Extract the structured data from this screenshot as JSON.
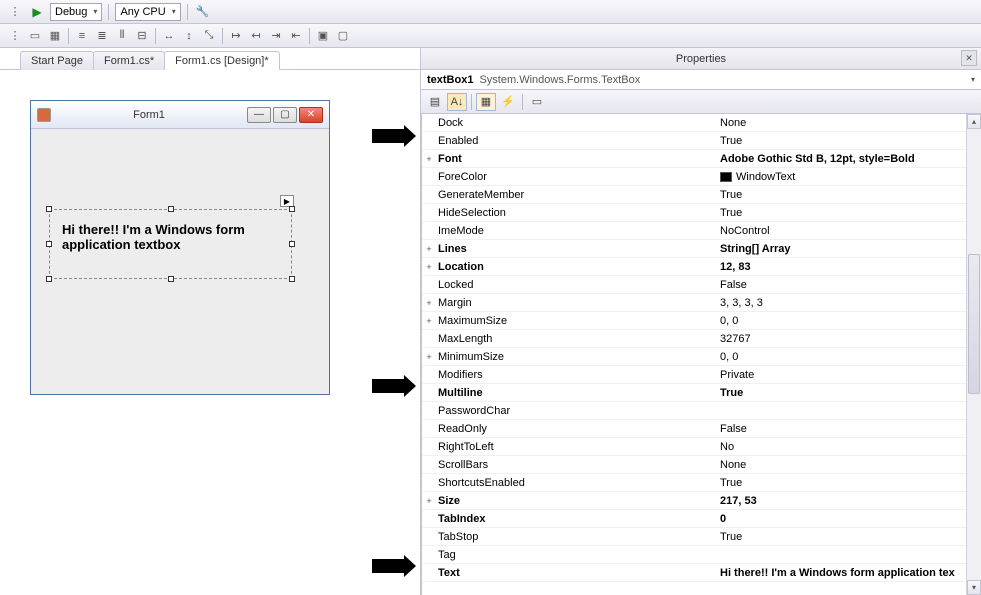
{
  "toolbar": {
    "config": "Debug",
    "platform": "Any CPU"
  },
  "tabs": {
    "start": "Start Page",
    "code": "Form1.cs*",
    "design": "Form1.cs [Design]*"
  },
  "form": {
    "title": "Form1",
    "textbox_text": "Hi there!! I'm a Windows form application textbox"
  },
  "properties": {
    "panel_title": "Properties",
    "object_name": "textBox1",
    "object_type": "System.Windows.Forms.TextBox",
    "rows": [
      {
        "exp": "",
        "name": "Dock",
        "value": "None",
        "bold": false
      },
      {
        "exp": "",
        "name": "Enabled",
        "value": "True",
        "bold": false
      },
      {
        "exp": "+",
        "name": "Font",
        "value": "Adobe Gothic Std B, 12pt, style=Bold",
        "bold": true
      },
      {
        "exp": "",
        "name": "ForeColor",
        "value": "WindowText",
        "bold": false,
        "swatch": true
      },
      {
        "exp": "",
        "name": "GenerateMember",
        "value": "True",
        "bold": false
      },
      {
        "exp": "",
        "name": "HideSelection",
        "value": "True",
        "bold": false
      },
      {
        "exp": "",
        "name": "ImeMode",
        "value": "NoControl",
        "bold": false
      },
      {
        "exp": "+",
        "name": "Lines",
        "value": "String[] Array",
        "bold": true
      },
      {
        "exp": "+",
        "name": "Location",
        "value": "12, 83",
        "bold": true
      },
      {
        "exp": "",
        "name": "Locked",
        "value": "False",
        "bold": false
      },
      {
        "exp": "+",
        "name": "Margin",
        "value": "3, 3, 3, 3",
        "bold": false
      },
      {
        "exp": "+",
        "name": "MaximumSize",
        "value": "0, 0",
        "bold": false
      },
      {
        "exp": "",
        "name": "MaxLength",
        "value": "32767",
        "bold": false
      },
      {
        "exp": "+",
        "name": "MinimumSize",
        "value": "0, 0",
        "bold": false
      },
      {
        "exp": "",
        "name": "Modifiers",
        "value": "Private",
        "bold": false
      },
      {
        "exp": "",
        "name": "Multiline",
        "value": "True",
        "bold": true
      },
      {
        "exp": "",
        "name": "PasswordChar",
        "value": "",
        "bold": false
      },
      {
        "exp": "",
        "name": "ReadOnly",
        "value": "False",
        "bold": false
      },
      {
        "exp": "",
        "name": "RightToLeft",
        "value": "No",
        "bold": false
      },
      {
        "exp": "",
        "name": "ScrollBars",
        "value": "None",
        "bold": false
      },
      {
        "exp": "",
        "name": "ShortcutsEnabled",
        "value": "True",
        "bold": false
      },
      {
        "exp": "+",
        "name": "Size",
        "value": "217, 53",
        "bold": true
      },
      {
        "exp": "",
        "name": "TabIndex",
        "value": "0",
        "bold": true
      },
      {
        "exp": "",
        "name": "TabStop",
        "value": "True",
        "bold": false
      },
      {
        "exp": "",
        "name": "Tag",
        "value": "",
        "bold": false
      },
      {
        "exp": "",
        "name": "Text",
        "value": "Hi there!! I'm a Windows form application tex",
        "bold": true,
        "dd": true
      }
    ]
  }
}
